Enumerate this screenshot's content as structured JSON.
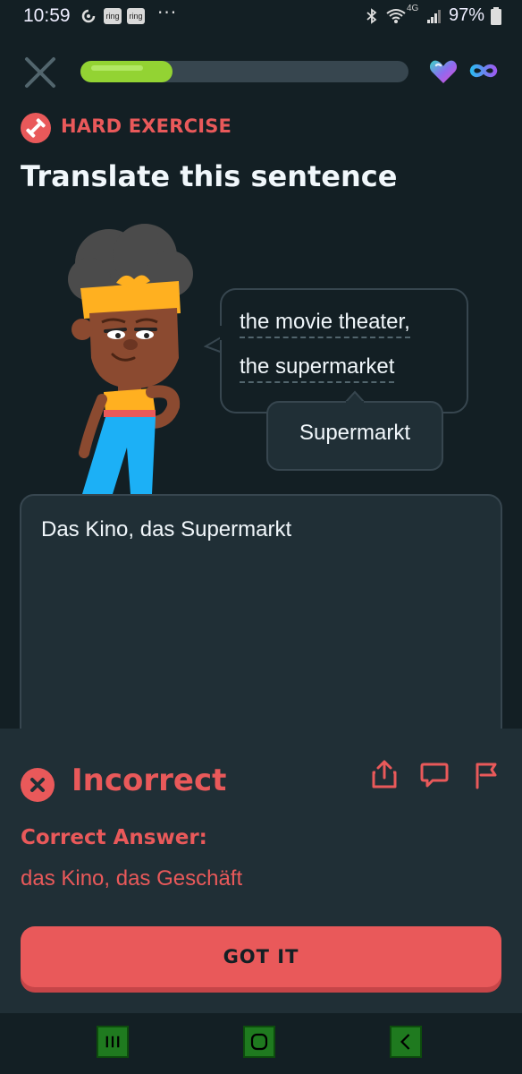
{
  "status_bar": {
    "time": "10:59",
    "ring_badge": "ring",
    "more": "···",
    "network": "4G",
    "battery": "97%"
  },
  "top_bar": {
    "progress_fraction": 0.28,
    "colors": {
      "progress": "#93d333",
      "track": "#37464f"
    }
  },
  "header": {
    "tag": "HARD EXERCISE",
    "title": "Translate this sentence"
  },
  "prompt": {
    "line1": "the movie theater,",
    "line2": "the supermarket",
    "tooltip": "Supermarkt"
  },
  "answer": {
    "value": "Das Kino, das Supermarkt"
  },
  "result": {
    "status": "Incorrect",
    "correct_label": "Correct Answer:",
    "correct_value": "das Kino, das Geschäft",
    "button": "GOT IT",
    "icons": [
      "share-icon",
      "comment-icon",
      "flag-icon"
    ],
    "colors": {
      "error": "#e9595a"
    }
  },
  "nav": {
    "items": [
      "recents-icon",
      "home-icon",
      "back-icon"
    ]
  }
}
